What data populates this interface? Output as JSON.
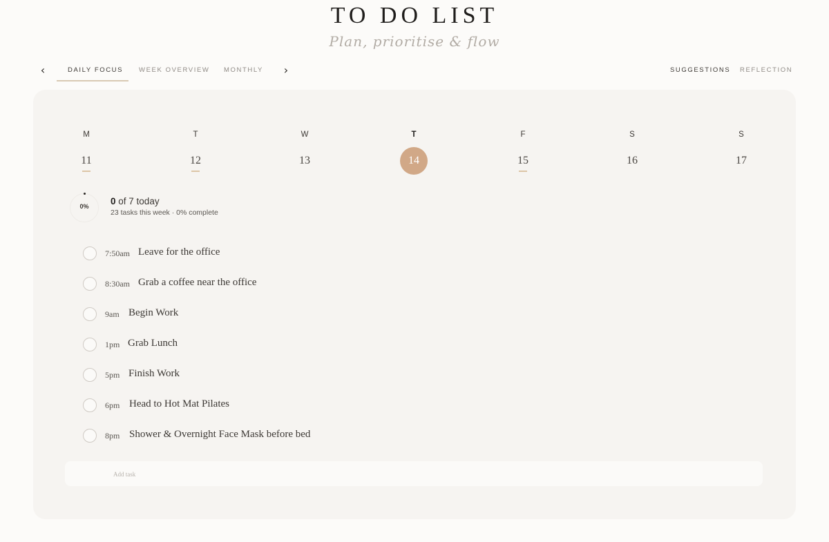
{
  "header": {
    "title": "TO DO LIST",
    "subtitle": "Plan, prioritise & flow"
  },
  "nav": {
    "prev_icon": "chevron-left",
    "next_icon": "chevron-right",
    "tabs": [
      {
        "label": "DAILY FOCUS",
        "active": true
      },
      {
        "label": "WEEK OVERVIEW",
        "active": false
      },
      {
        "label": "MONTHLY",
        "active": false
      }
    ],
    "right_tabs": [
      {
        "label": "SUGGESTIONS"
      },
      {
        "label": "REFLECTION"
      }
    ]
  },
  "week": {
    "days": [
      {
        "letter": "M",
        "date": "11",
        "has_tasks": true,
        "today": false
      },
      {
        "letter": "T",
        "date": "12",
        "has_tasks": true,
        "today": false
      },
      {
        "letter": "W",
        "date": "13",
        "has_tasks": false,
        "today": false
      },
      {
        "letter": "T",
        "date": "14",
        "has_tasks": false,
        "today": true
      },
      {
        "letter": "F",
        "date": "15",
        "has_tasks": true,
        "today": false
      },
      {
        "letter": "S",
        "date": "16",
        "has_tasks": false,
        "today": false
      },
      {
        "letter": "S",
        "date": "17",
        "has_tasks": false,
        "today": false
      }
    ]
  },
  "progress": {
    "percent": "0%",
    "done": "0",
    "of_text": "of 7 today",
    "week_summary": "23 tasks this week · 0% complete"
  },
  "tasks": [
    {
      "time": "7:50am",
      "label": "Leave for the office"
    },
    {
      "time": "8:30am",
      "label": "Grab a coffee near the office"
    },
    {
      "time": "9am",
      "label": "Begin Work"
    },
    {
      "time": "1pm",
      "label": "Grab Lunch"
    },
    {
      "time": "5pm",
      "label": "Finish Work"
    },
    {
      "time": "6pm",
      "label": "Head to Hot Mat Pilates"
    },
    {
      "time": "8pm",
      "label": "Shower & Overnight Face Mask before bed"
    }
  ],
  "add_task": {
    "placeholder": "Add task",
    "value": ""
  },
  "colors": {
    "accent": "#d1a887",
    "day_marker": "#dcc5a6",
    "card_bg": "#f6f4f1",
    "page_bg": "#fcfbf9"
  }
}
